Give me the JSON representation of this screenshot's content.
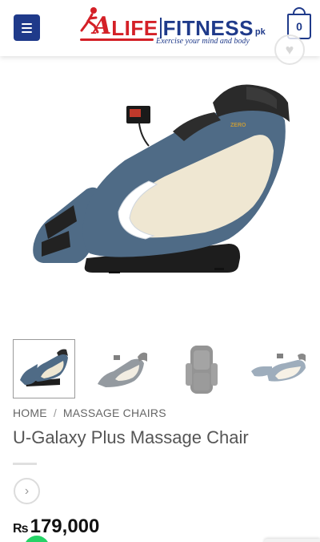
{
  "header": {
    "logo": {
      "a": "A",
      "life": "LIFE",
      "fitness": "FITNESS",
      "pk": "pk",
      "tagline": "Exercise your mind and body"
    },
    "cart_count": "0"
  },
  "product": {
    "breadcrumb": [
      "HOME",
      "MASSAGE CHAIRS"
    ],
    "breadcrumb_sep": "/",
    "title": "U-Galaxy Plus Massage Chair",
    "price_currency": "₨",
    "price_amount": "179,000",
    "chair_badge": "ZERO"
  },
  "colors": {
    "brand_blue": "#1f3a8a",
    "brand_red": "#d42027",
    "chair_blue": "#4f6b86",
    "chair_cream": "#efe7d2"
  }
}
